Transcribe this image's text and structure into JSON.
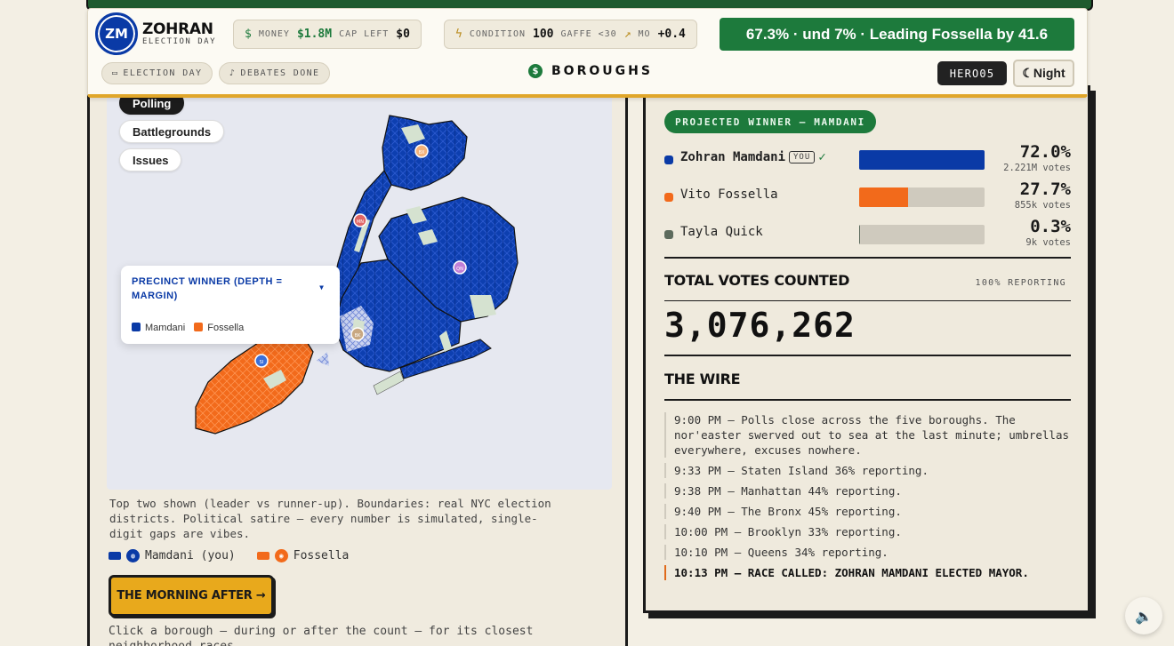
{
  "header": {
    "logo_initials": "ZM",
    "brand_name": "ZOHRAN",
    "brand_sub": "ELECTION DAY",
    "money_icon": "$",
    "money_label": "MONEY",
    "money_value": "$1.8M",
    "cap_label": "CAP LEFT",
    "cap_value": "$0",
    "condition_label": "CONDITION",
    "condition_value": "100",
    "gaffe_label": "GAFFE <30",
    "mo_label": "MO",
    "mo_value": "+0.4",
    "headline": "67.3% · und 7% · Leading Fossella by 41.6",
    "chip_election_day": "ELECTION DAY",
    "chip_debates": "DEBATES DONE",
    "section": "BOROUGHS",
    "section_icon": "$",
    "hero_tag": "HERO05",
    "night_button": "☾Night"
  },
  "map": {
    "modes": [
      "Polling",
      "Battlegrounds",
      "Issues"
    ],
    "active_mode": "Polling",
    "legend_title": "PRECINCT WINNER (DEPTH = MARGIN)",
    "legend_items": [
      "Mamdani",
      "Fossella"
    ],
    "borough_markers": [
      "BX",
      "MN",
      "QN",
      "BK",
      "SI"
    ],
    "colors": {
      "mamdani": "#0a3aa6",
      "fossella": "#f26a1b",
      "map_bg": "#e6e8f0",
      "park": "#d5e2d0"
    }
  },
  "footnote": "Top two shown (leader vs runner-up). Boundaries: real NYC election districts. Political satire — every number is simulated, single-digit gaps are vibes.",
  "key": {
    "mamdani": "Mamdani (you)",
    "fossella": "Fossella"
  },
  "morning_button": "THE MORNING AFTER →",
  "click_note": "Click a borough — during or after the count — for its closest neighborhood races.",
  "results": {
    "badge": "PROJECTED WINNER — MAMDANI",
    "you_tag": "YOU",
    "check": "✓",
    "candidates": [
      {
        "name": "Zohran Mamdani",
        "pct": "72.0%",
        "votes": "2.221M votes",
        "share": 72.0,
        "color": "#0a3aa6"
      },
      {
        "name": "Vito Fossella",
        "pct": "27.7%",
        "votes": "855k votes",
        "share": 27.7,
        "color": "#f26a1b"
      },
      {
        "name": "Tayla Quick",
        "pct": "0.3%",
        "votes": "9k votes",
        "share": 0.3,
        "color": "#5d6b5d"
      }
    ],
    "total_label": "TOTAL VOTES COUNTED",
    "reporting": "100% REPORTING",
    "total_value": "3,076,262",
    "wire_title": "THE WIRE",
    "wire": [
      "9:00 PM — Polls close across the five boroughs. The nor'easter swerved out to sea at the last minute; umbrellas everywhere, excuses nowhere.",
      "9:33 PM — Staten Island 36% reporting.",
      "9:38 PM — Manhattan 44% reporting.",
      "9:40 PM — The Bronx 45% reporting.",
      "10:00 PM — Brooklyn 33% reporting.",
      "10:10 PM — Queens 34% reporting.",
      "10:13 PM — RACE CALLED: ZOHRAN MAMDANI ELECTED MAYOR."
    ]
  },
  "sound_icon": "speaker-icon"
}
